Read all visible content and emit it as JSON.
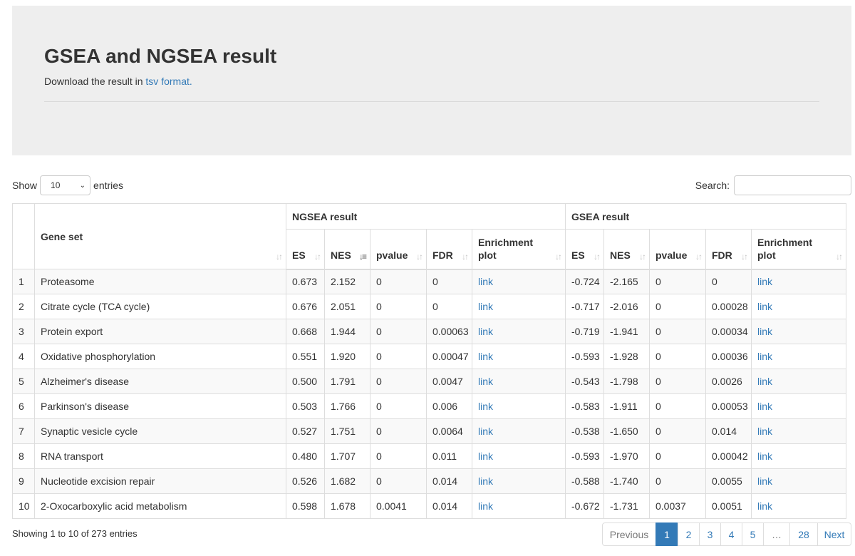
{
  "header": {
    "title": "GSEA and NGSEA result",
    "download_prefix": "Download the result in",
    "download_link": "tsv format."
  },
  "controls": {
    "show_label": "Show",
    "page_size": "10",
    "entries_label": "entries",
    "search_label": "Search:",
    "search_value": ""
  },
  "table": {
    "groups": {
      "ngsea": "NGSEA result",
      "gsea": "GSEA result"
    },
    "columns": {
      "gene_set": "Gene set",
      "es": "ES",
      "nes": "NES",
      "pvalue": "pvalue",
      "fdr": "FDR",
      "plot_line1": "Enrichment",
      "plot_line2": "plot"
    },
    "sorted_column": "NGSEA NES (descending)",
    "rows": [
      {
        "n": "1",
        "set": "Proteasome",
        "nes_es": "0.673",
        "nes_nes": "2.152",
        "nes_p": "0",
        "nes_fdr": "0",
        "nes_plot": "link",
        "g_es": "-0.724",
        "g_nes": "-2.165",
        "g_p": "0",
        "g_fdr": "0",
        "g_plot": "link"
      },
      {
        "n": "2",
        "set": "Citrate cycle (TCA cycle)",
        "nes_es": "0.676",
        "nes_nes": "2.051",
        "nes_p": "0",
        "nes_fdr": "0",
        "nes_plot": "link",
        "g_es": "-0.717",
        "g_nes": "-2.016",
        "g_p": "0",
        "g_fdr": "0.00028",
        "g_plot": "link"
      },
      {
        "n": "3",
        "set": "Protein export",
        "nes_es": "0.668",
        "nes_nes": "1.944",
        "nes_p": "0",
        "nes_fdr": "0.00063",
        "nes_plot": "link",
        "g_es": "-0.719",
        "g_nes": "-1.941",
        "g_p": "0",
        "g_fdr": "0.00034",
        "g_plot": "link"
      },
      {
        "n": "4",
        "set": "Oxidative phosphorylation",
        "nes_es": "0.551",
        "nes_nes": "1.920",
        "nes_p": "0",
        "nes_fdr": "0.00047",
        "nes_plot": "link",
        "g_es": "-0.593",
        "g_nes": "-1.928",
        "g_p": "0",
        "g_fdr": "0.00036",
        "g_plot": "link"
      },
      {
        "n": "5",
        "set": "Alzheimer's disease",
        "nes_es": "0.500",
        "nes_nes": "1.791",
        "nes_p": "0",
        "nes_fdr": "0.0047",
        "nes_plot": "link",
        "g_es": "-0.543",
        "g_nes": "-1.798",
        "g_p": "0",
        "g_fdr": "0.0026",
        "g_plot": "link"
      },
      {
        "n": "6",
        "set": "Parkinson's disease",
        "nes_es": "0.503",
        "nes_nes": "1.766",
        "nes_p": "0",
        "nes_fdr": "0.006",
        "nes_plot": "link",
        "g_es": "-0.583",
        "g_nes": "-1.911",
        "g_p": "0",
        "g_fdr": "0.00053",
        "g_plot": "link"
      },
      {
        "n": "7",
        "set": "Synaptic vesicle cycle",
        "nes_es": "0.527",
        "nes_nes": "1.751",
        "nes_p": "0",
        "nes_fdr": "0.0064",
        "nes_plot": "link",
        "g_es": "-0.538",
        "g_nes": "-1.650",
        "g_p": "0",
        "g_fdr": "0.014",
        "g_plot": "link"
      },
      {
        "n": "8",
        "set": "RNA transport",
        "nes_es": "0.480",
        "nes_nes": "1.707",
        "nes_p": "0",
        "nes_fdr": "0.011",
        "nes_plot": "link",
        "g_es": "-0.593",
        "g_nes": "-1.970",
        "g_p": "0",
        "g_fdr": "0.00042",
        "g_plot": "link"
      },
      {
        "n": "9",
        "set": "Nucleotide excision repair",
        "nes_es": "0.526",
        "nes_nes": "1.682",
        "nes_p": "0",
        "nes_fdr": "0.014",
        "nes_plot": "link",
        "g_es": "-0.588",
        "g_nes": "-1.740",
        "g_p": "0",
        "g_fdr": "0.0055",
        "g_plot": "link"
      },
      {
        "n": "10",
        "set": "2-Oxocarboxylic acid metabolism",
        "nes_es": "0.598",
        "nes_nes": "1.678",
        "nes_p": "0.0041",
        "nes_fdr": "0.014",
        "nes_plot": "link",
        "g_es": "-0.672",
        "g_nes": "-1.731",
        "g_p": "0.0037",
        "g_fdr": "0.0051",
        "g_plot": "link"
      }
    ]
  },
  "footer": {
    "info": "Showing 1 to 10 of 273 entries",
    "pagination": {
      "previous": "Previous",
      "pages": [
        "1",
        "2",
        "3",
        "4",
        "5",
        "…",
        "28"
      ],
      "active_page": "1",
      "next": "Next"
    }
  },
  "colors": {
    "link": "#337ab7",
    "jumbotron_bg": "#eeeeee",
    "active_page_bg": "#337ab7",
    "stripe": "#f9f9f9"
  }
}
